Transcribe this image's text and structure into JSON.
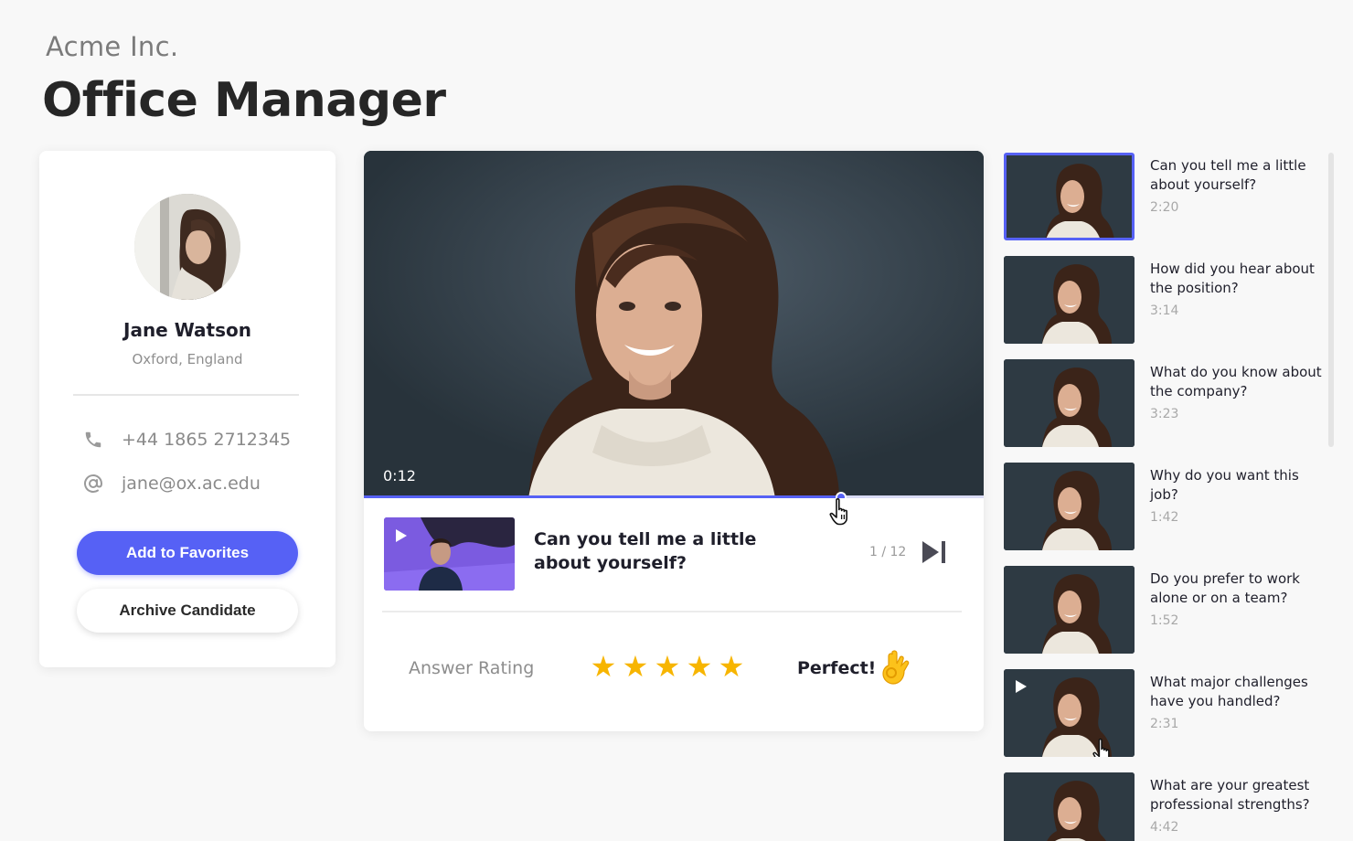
{
  "header": {
    "company": "Acme Inc.",
    "job_title": "Office Manager"
  },
  "candidate": {
    "name": "Jane Watson",
    "location": "Oxford, England",
    "phone": "+44 1865 2712345",
    "email": "jane@ox.ac.edu",
    "phone_icon": "phone-icon",
    "email_icon": "at-icon",
    "favorite_label": "Add to Favorites",
    "archive_label": "Archive Candidate"
  },
  "player": {
    "current_time": "0:12",
    "progress": 0.77,
    "question_text": "Can you tell me a little about yourself?",
    "counter": "1 / 12",
    "rating_label": "Answer Rating",
    "rating_value": 5,
    "rating_max": 5,
    "rating_word": "Perfect!",
    "rating_emoji": "ok-hand-icon"
  },
  "questions": [
    {
      "title": "Can you tell me a little about yourself?",
      "duration": "2:20",
      "selected": true
    },
    {
      "title": "How did you hear about the position?",
      "duration": "3:14"
    },
    {
      "title": "What do you know about the company?",
      "duration": "3:23"
    },
    {
      "title": "Why do you want this job?",
      "duration": "1:42"
    },
    {
      "title": "Do you prefer to work alone or on a team?",
      "duration": "1:52"
    },
    {
      "title": "What major challenges have you handled?",
      "duration": "2:31",
      "hovered": true
    },
    {
      "title": "What are your greatest professional strengths?",
      "duration": "4:42"
    }
  ],
  "colors": {
    "accent": "#5661f5",
    "star": "#f7b500",
    "background": "#f8f8f8"
  }
}
